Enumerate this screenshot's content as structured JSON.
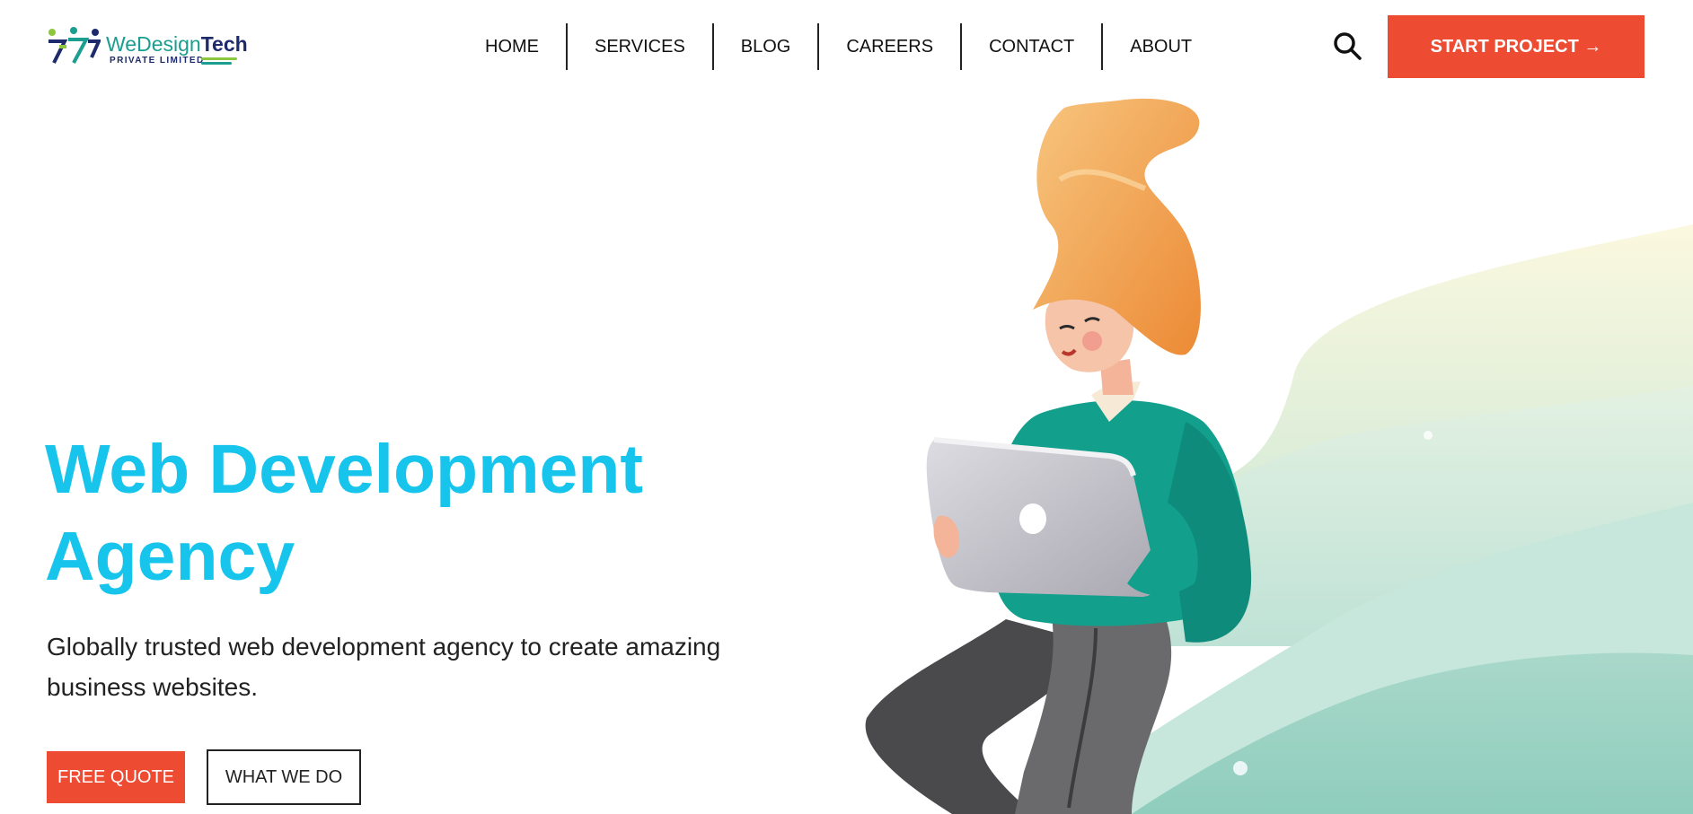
{
  "brand": {
    "name_part1": "WeDesign",
    "name_part2": "Tech",
    "subtitle": "PRIVATE LIMITED",
    "colors": {
      "teal": "#1a9e8f",
      "navy": "#1d2a6b",
      "lime": "#8dc63f"
    }
  },
  "nav": {
    "items": [
      {
        "label": "HOME"
      },
      {
        "label": "SERVICES"
      },
      {
        "label": "BLOG"
      },
      {
        "label": "CAREERS"
      },
      {
        "label": "CONTACT"
      },
      {
        "label": "ABOUT"
      }
    ],
    "search_icon": "search-icon",
    "cta_label": "START PROJECT →"
  },
  "hero": {
    "title_line1": "Web Development",
    "title_line2": "Agency",
    "description": "Globally trusted web development agency to create amazing business websites.",
    "primary_button": "FREE QUOTE",
    "secondary_button": "WHAT WE DO",
    "illustration": "woman-with-laptop-illustration"
  },
  "colors": {
    "accent": "#ee4b33",
    "title": "#17c4ec",
    "sweater": "#12a08d",
    "hair": "#f2a650"
  }
}
